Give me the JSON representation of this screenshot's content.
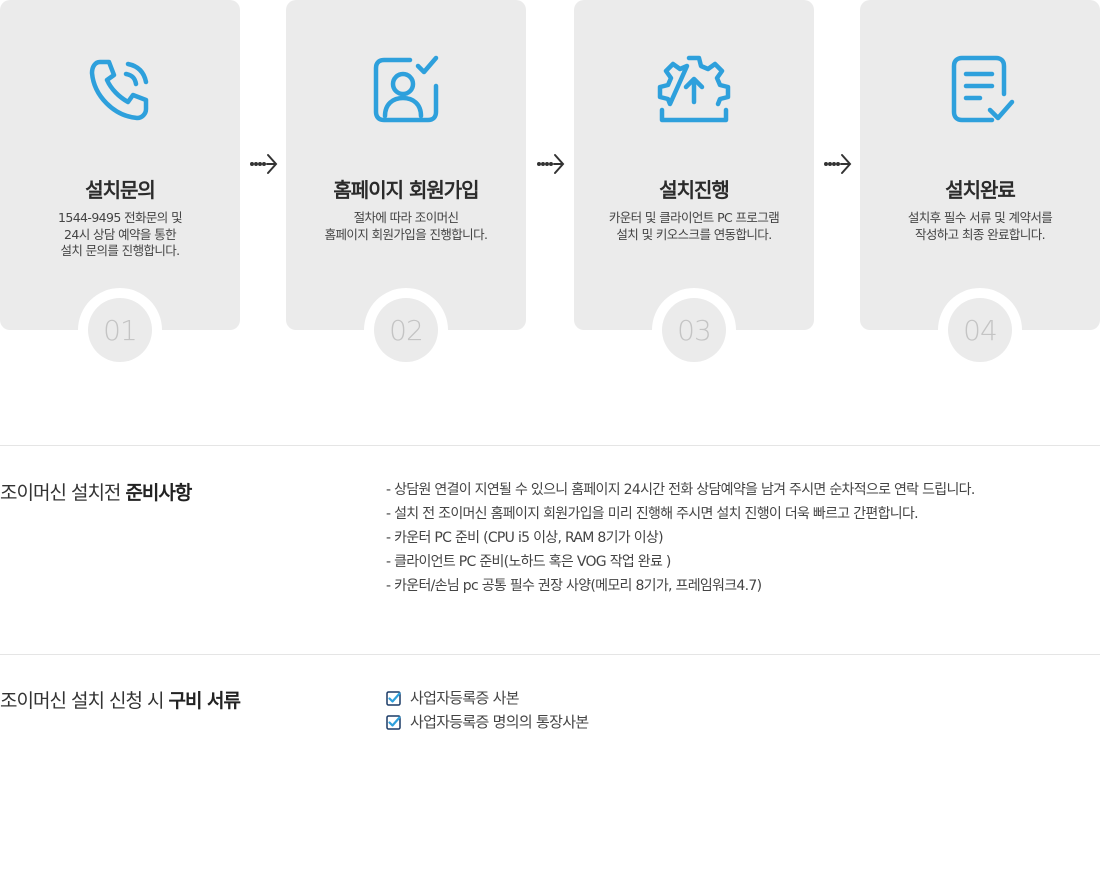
{
  "colors": {
    "accent": "#2ea0dc",
    "card_bg": "#ebebeb",
    "number": "#c4c4c4"
  },
  "steps": [
    {
      "icon": "phone-icon",
      "title": "설치문의",
      "desc": [
        "1544-9495 전화문의 및",
        "24시 상담 예약을 통한",
        "설치 문의를 진행합니다."
      ],
      "number": "01"
    },
    {
      "icon": "user-check-icon",
      "title": "홈페이지 회원가입",
      "desc": [
        "절차에 따라 조이머신",
        "홈페이지 회원가입을 진행합니다."
      ],
      "number": "02"
    },
    {
      "icon": "gear-upload-icon",
      "title": "설치진행",
      "desc": [
        "카운터 및 클라이언트 PC 프로그램",
        "설치 및 키오스크를 연동합니다."
      ],
      "number": "03"
    },
    {
      "icon": "document-check-icon",
      "title": "설치완료",
      "desc": [
        "설치후 필수 서류 및 계약서를",
        "작성하고 최종 완료합니다."
      ],
      "number": "04"
    }
  ],
  "prep": {
    "title_plain": "조이머신 설치전 ",
    "title_bold": "준비사항",
    "notes": [
      "- 상담원 연결이 지연될 수 있으니 홈페이지 24시간 전화 상담예약을 남겨 주시면 순차적으로 연락 드립니다.",
      "- 설치 전 조이머신 홈페이지 회원가입을 미리 진행해 주시면 설치 진행이 더욱 빠르고 간편합니다.",
      "- 카운터 PC 준비 (CPU i5 이상, RAM 8기가 이상)",
      "- 클라이언트 PC 준비(노하드 혹은 VOG 작업 완료 )",
      "- 카운터/손님 pc 공통 필수 권장 사양(메모리 8기가, 프레임워크4.7)"
    ]
  },
  "docs": {
    "title_plain": "조이머신 설치 신청 시 ",
    "title_bold": "구비 서류",
    "items": [
      "사업자등록증 사본",
      "사업자등록증 명의의 통장사본"
    ]
  }
}
